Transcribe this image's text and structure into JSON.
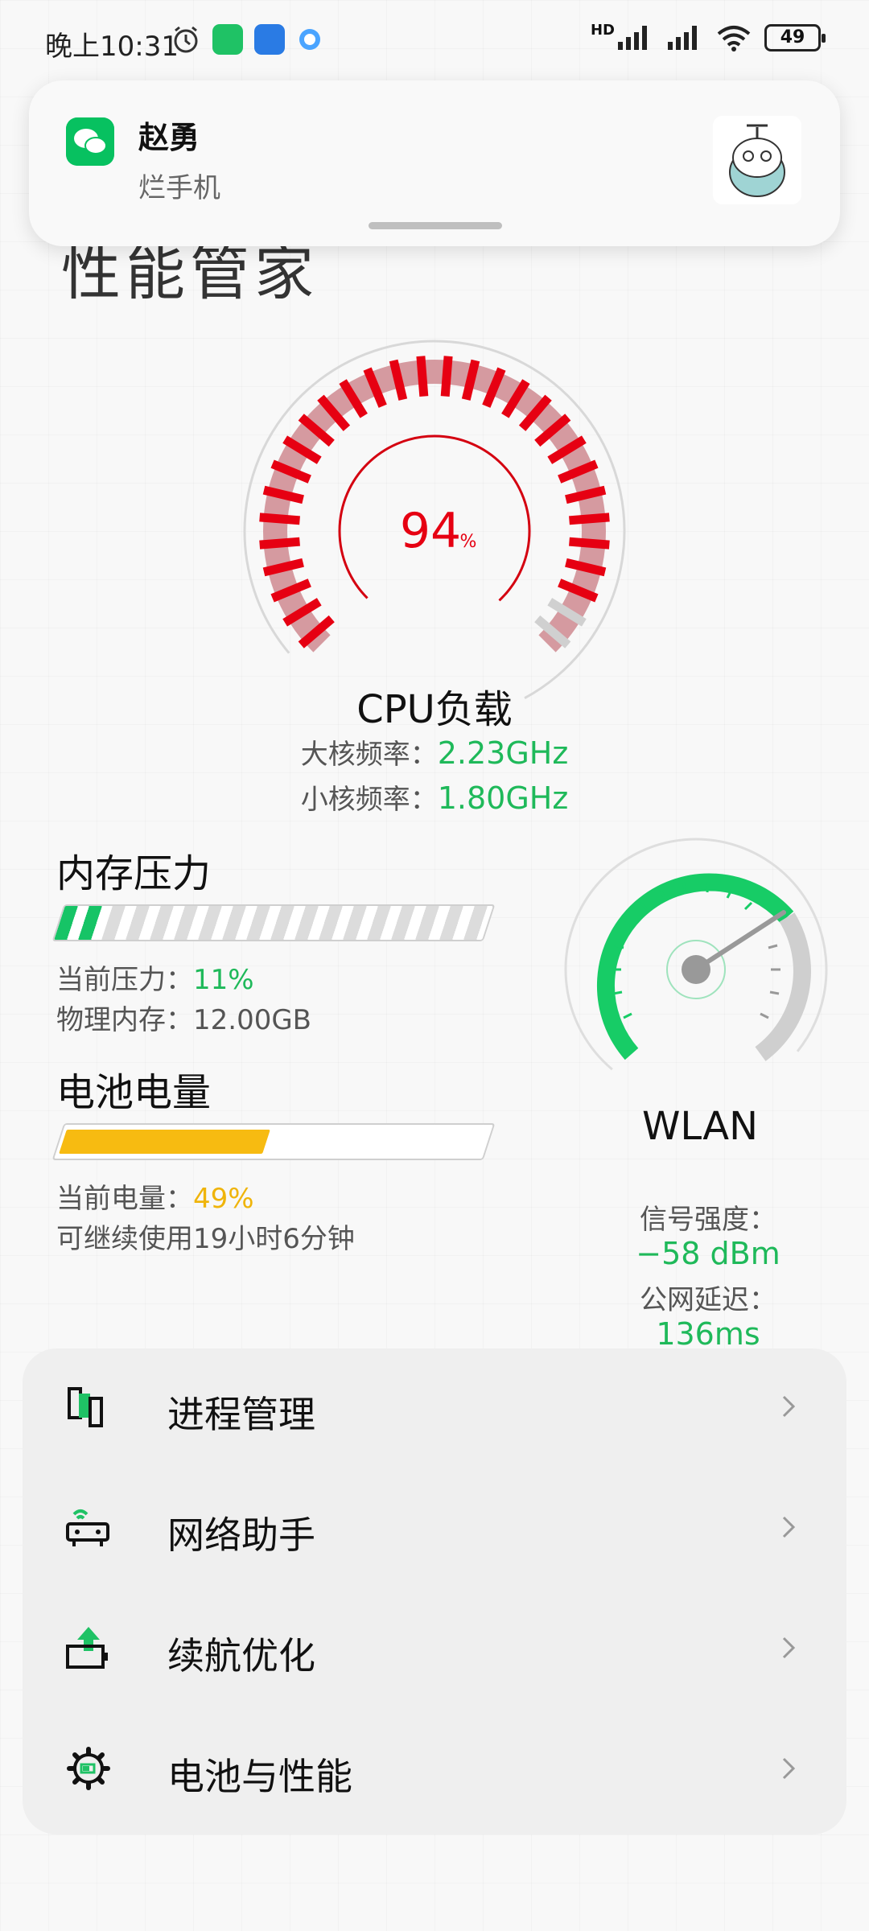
{
  "status_bar": {
    "time": "晚上10:31",
    "network_label": "HD",
    "battery": "49"
  },
  "notification": {
    "app_icon": "wechat-icon",
    "title": "赵勇",
    "body": "烂手机"
  },
  "page_title_partial": "性能管家",
  "cpu": {
    "percent": "94",
    "percent_unit": "%",
    "load_fraction": 0.94,
    "title": "CPU负载",
    "big_core_label": "大核频率：",
    "big_core_value": "2.23GHz",
    "small_core_label": "小核频率：",
    "small_core_value": "1.80GHz"
  },
  "memory": {
    "title": "内存压力",
    "pressure_label": "当前压力：",
    "pressure_value": "11%",
    "pressure_fraction": 0.11,
    "physical_label": "物理内存：",
    "physical_value": "12.00GB"
  },
  "battery": {
    "title": "电池电量",
    "level_label": "当前电量：",
    "level_value": "49%",
    "level_fraction": 0.49,
    "remaining": "可继续使用19小时6分钟"
  },
  "wlan": {
    "title": "WLAN",
    "signal_label": "信号强度：",
    "signal_value": "−58 dBm",
    "latency_label": "公网延迟：",
    "latency_value": "136ms"
  },
  "menu": {
    "items": [
      {
        "label": "进程管理",
        "icon": "process-icon"
      },
      {
        "label": "网络助手",
        "icon": "router-icon"
      },
      {
        "label": "续航优化",
        "icon": "battery-boost-icon"
      },
      {
        "label": "电池与性能",
        "icon": "gear-icon"
      }
    ]
  },
  "colors": {
    "accent_green": "#1fb95a",
    "cpu_red": "#e60012",
    "battery_yellow": "#f7bb11"
  }
}
